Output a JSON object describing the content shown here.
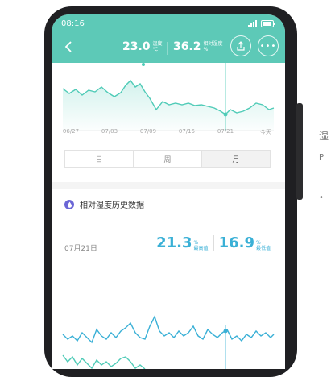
{
  "status_bar": {
    "time": "08:16"
  },
  "header": {
    "temperature": "23.0",
    "temp_label": "温度",
    "temp_unit": "℃",
    "humidity": "36.2",
    "humidity_label": "相对湿度",
    "humidity_unit": "%",
    "separator": "|",
    "more_label": "•••"
  },
  "colors": {
    "accent": "#5dc9b7",
    "line_teal": "#4fcbb7",
    "line_blue": "#3ab0d6",
    "icon_purple": "#6b66d6"
  },
  "top_chart": {
    "x_labels": [
      "06/27",
      "07/03",
      "07/09",
      "07/15",
      "07/21",
      "今天"
    ]
  },
  "tabs": {
    "items": [
      "日",
      "周",
      "月"
    ],
    "active": "月"
  },
  "history": {
    "title": "相对湿度历史数据",
    "date": "07月21日",
    "max_value": "21.3",
    "max_unit": "%",
    "max_label": "最高值",
    "min_value": "16.9",
    "min_unit": "%",
    "min_label": "最低值"
  },
  "peek": [
    "湿",
    "P",
    "•"
  ]
}
